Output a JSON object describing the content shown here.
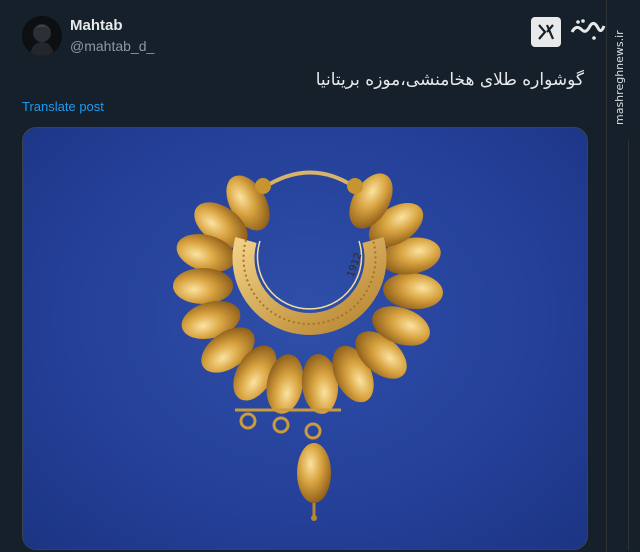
{
  "post": {
    "display_name": "Mahtab",
    "handle": "@mahtab_d_",
    "text": "گوشواره طلای هخامنشی،موزه بریتانیا",
    "translate_label": "Translate post"
  },
  "media": {
    "description_icon": "image-icon",
    "engraving": "1912"
  },
  "watermark": {
    "text": "mashreghnews.ir",
    "logo": "مشرق"
  },
  "colors": {
    "background": "#15202b",
    "link": "#1d9bf0",
    "photo_blue": "#2b479e",
    "gold": "#d9a441"
  }
}
